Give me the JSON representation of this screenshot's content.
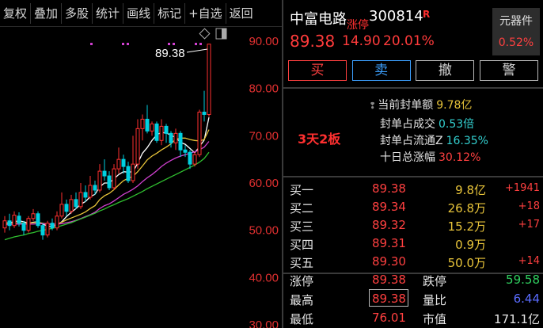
{
  "toolbar": {
    "items": [
      "复权",
      "叠加",
      "多股",
      "统计",
      "画线",
      "标记",
      "+自选",
      "返回"
    ]
  },
  "chart": {
    "y_labels": [
      "90.00",
      "80.00",
      "70.00",
      "60.00",
      "50.00",
      "40.00",
      "30.00"
    ],
    "last_price_label": "89.38",
    "colors": {
      "up": "#ff3030",
      "down": "#00d0e0",
      "ma5": "#ffffff",
      "ma10": "#e8c43a",
      "ma20": "#d040d0",
      "ma60": "#30c030"
    }
  },
  "chart_data": {
    "type": "candlestick",
    "ylim": [
      30,
      90
    ],
    "candles": [
      {
        "o": 50.5,
        "c": 52.0,
        "h": 53.0,
        "l": 49.5
      },
      {
        "o": 52.0,
        "c": 51.0,
        "h": 53.5,
        "l": 50.0
      },
      {
        "o": 51.0,
        "c": 53.2,
        "h": 54.0,
        "l": 50.5
      },
      {
        "o": 53.0,
        "c": 51.5,
        "h": 53.8,
        "l": 50.8
      },
      {
        "o": 51.5,
        "c": 50.0,
        "h": 52.0,
        "l": 49.0
      },
      {
        "o": 50.0,
        "c": 52.5,
        "h": 53.0,
        "l": 49.5
      },
      {
        "o": 52.5,
        "c": 53.5,
        "h": 54.5,
        "l": 52.0
      },
      {
        "o": 53.5,
        "c": 51.0,
        "h": 54.0,
        "l": 50.5
      },
      {
        "o": 51.0,
        "c": 49.0,
        "h": 51.5,
        "l": 48.0
      },
      {
        "o": 49.0,
        "c": 51.5,
        "h": 52.0,
        "l": 48.5
      },
      {
        "o": 51.5,
        "c": 50.5,
        "h": 52.5,
        "l": 50.0
      },
      {
        "o": 50.5,
        "c": 53.0,
        "h": 54.0,
        "l": 50.0
      },
      {
        "o": 53.0,
        "c": 55.5,
        "h": 58.0,
        "l": 52.5
      },
      {
        "o": 55.5,
        "c": 54.0,
        "h": 56.5,
        "l": 53.0
      },
      {
        "o": 54.0,
        "c": 56.5,
        "h": 57.5,
        "l": 53.5
      },
      {
        "o": 56.5,
        "c": 55.0,
        "h": 58.0,
        "l": 54.5
      },
      {
        "o": 55.0,
        "c": 58.0,
        "h": 60.0,
        "l": 54.5
      },
      {
        "o": 58.0,
        "c": 57.0,
        "h": 59.5,
        "l": 56.0
      },
      {
        "o": 57.0,
        "c": 59.5,
        "h": 61.5,
        "l": 56.5
      },
      {
        "o": 59.5,
        "c": 58.5,
        "h": 60.5,
        "l": 57.5
      },
      {
        "o": 58.5,
        "c": 62.5,
        "h": 64.0,
        "l": 58.0
      },
      {
        "o": 62.5,
        "c": 61.5,
        "h": 65.0,
        "l": 60.5
      },
      {
        "o": 61.5,
        "c": 59.0,
        "h": 62.5,
        "l": 58.5
      },
      {
        "o": 59.0,
        "c": 63.0,
        "h": 64.0,
        "l": 58.5
      },
      {
        "o": 63.0,
        "c": 65.0,
        "h": 67.5,
        "l": 62.0
      },
      {
        "o": 65.0,
        "c": 63.5,
        "h": 66.0,
        "l": 62.0
      },
      {
        "o": 63.5,
        "c": 60.5,
        "h": 64.5,
        "l": 60.0
      },
      {
        "o": 60.5,
        "c": 64.0,
        "h": 70.0,
        "l": 60.0
      },
      {
        "o": 64.0,
        "c": 71.5,
        "h": 73.5,
        "l": 63.0
      },
      {
        "o": 71.5,
        "c": 73.5,
        "h": 74.5,
        "l": 69.0
      },
      {
        "o": 73.5,
        "c": 71.0,
        "h": 76.5,
        "l": 70.5
      },
      {
        "o": 71.0,
        "c": 72.5,
        "h": 73.0,
        "l": 70.0
      },
      {
        "o": 72.5,
        "c": 69.0,
        "h": 73.0,
        "l": 68.5
      },
      {
        "o": 69.0,
        "c": 72.0,
        "h": 73.5,
        "l": 68.0
      },
      {
        "o": 72.0,
        "c": 70.5,
        "h": 72.5,
        "l": 68.5
      },
      {
        "o": 70.5,
        "c": 68.5,
        "h": 71.0,
        "l": 67.5
      },
      {
        "o": 68.5,
        "c": 70.5,
        "h": 71.5,
        "l": 67.0
      },
      {
        "o": 70.5,
        "c": 67.0,
        "h": 71.0,
        "l": 65.5
      },
      {
        "o": 67.0,
        "c": 66.5,
        "h": 68.0,
        "l": 65.5
      },
      {
        "o": 66.5,
        "c": 64.0,
        "h": 67.0,
        "l": 63.0
      },
      {
        "o": 64.0,
        "c": 66.0,
        "h": 66.5,
        "l": 63.5
      },
      {
        "o": 66.0,
        "c": 75.0,
        "h": 75.5,
        "l": 65.5
      },
      {
        "o": 75.0,
        "c": 74.5,
        "h": 79.5,
        "l": 73.0
      },
      {
        "o": 74.5,
        "c": 89.38,
        "h": 89.38,
        "l": 74.0
      }
    ],
    "series": [
      {
        "values": [
          51.5,
          51.6,
          51.8,
          52.0,
          51.8,
          51.5,
          51.7,
          51.8,
          51.3,
          50.9,
          50.8,
          51.1,
          51.8,
          52.9,
          53.8,
          54.6,
          55.5,
          56.1,
          57.1,
          57.6,
          59.2,
          60.0,
          60.0,
          60.9,
          61.8,
          62.4,
          62.3,
          62.4,
          64.2,
          66.3,
          67.5,
          69.0,
          70.2,
          70.7,
          70.6,
          70.1,
          69.6,
          68.6,
          68.2,
          67.3,
          66.4,
          67.7,
          69.1,
          73.9
        ]
      },
      {
        "values": [
          51.5,
          51.4,
          51.5,
          51.6,
          51.5,
          51.5,
          51.6,
          51.7,
          51.5,
          51.3,
          51.2,
          51.3,
          51.7,
          52.2,
          52.6,
          53.0,
          53.4,
          53.9,
          54.6,
          55.2,
          56.5,
          57.3,
          57.8,
          58.6,
          59.6,
          60.5,
          61.0,
          61.4,
          62.4,
          63.6,
          64.9,
          65.7,
          66.3,
          67.0,
          67.6,
          68.3,
          69.3,
          69.5,
          69.5,
          69.2,
          69.0,
          68.9,
          69.2,
          71.3
        ]
      },
      {
        "values": [
          51.2,
          51.2,
          51.3,
          51.3,
          51.3,
          51.3,
          51.3,
          51.4,
          51.4,
          51.3,
          51.3,
          51.3,
          51.4,
          51.6,
          51.8,
          52.1,
          52.5,
          52.9,
          53.3,
          53.8,
          54.6,
          55.2,
          55.6,
          56.2,
          56.9,
          57.6,
          58.1,
          58.7,
          59.4,
          60.3,
          61.1,
          61.8,
          62.6,
          63.5,
          64.2,
          64.8,
          65.3,
          65.7,
          66.0,
          66.3,
          66.6,
          67.0,
          67.6,
          68.8
        ]
      },
      {
        "values": [
          48.0,
          48.3,
          48.6,
          48.8,
          49.0,
          49.3,
          49.5,
          49.8,
          50.0,
          50.2,
          50.4,
          50.7,
          51.0,
          51.3,
          51.6,
          52.0,
          52.4,
          52.8,
          53.2,
          53.6,
          54.1,
          54.5,
          55.0,
          55.4,
          55.9,
          56.3,
          56.7,
          57.2,
          57.7,
          58.2,
          58.8,
          59.3,
          59.8,
          60.3,
          60.8,
          61.3,
          61.8,
          62.3,
          62.8,
          63.3,
          63.8,
          64.4,
          65.2,
          66.5
        ]
      }
    ]
  },
  "quote": {
    "name": "中富电路",
    "badge": "涨停",
    "code": "300814",
    "rz": "R",
    "price": "89.38",
    "change": "14.90",
    "pct": "20.01%"
  },
  "sector": {
    "name": "元器件",
    "pct": "0.52%"
  },
  "actions": {
    "buy": "买",
    "sell": "卖",
    "cancel": "撤",
    "alert": "警"
  },
  "limit_up": {
    "tag": "3天2板",
    "stats": [
      {
        "label": "当前封单额",
        "value": "9.78亿"
      },
      {
        "label": "封单占成交",
        "value": "0.53倍"
      },
      {
        "label": "封单占流通Z",
        "value": "16.35%"
      },
      {
        "label": "十日总涨幅",
        "value": "30.12%"
      }
    ]
  },
  "orderbook": [
    {
      "label": "买一",
      "price": "89.38",
      "vol": "9.8亿",
      "delta": "+1941"
    },
    {
      "label": "买二",
      "price": "89.34",
      "vol": "26.8万",
      "delta": "+18"
    },
    {
      "label": "买三",
      "price": "89.32",
      "vol": "15.2万",
      "delta": "+17"
    },
    {
      "label": "买四",
      "price": "89.31",
      "vol": "0.9万",
      "delta": ""
    },
    {
      "label": "买五",
      "price": "89.30",
      "vol": "50.0万",
      "delta": "+14"
    }
  ],
  "summary": [
    {
      "l1": "涨停",
      "v1": "89.38",
      "l2": "跌停",
      "v2": "59.58"
    },
    {
      "l1": "最高",
      "v1": "89.38",
      "l2": "量比",
      "v2": "6.44"
    },
    {
      "l1": "最低",
      "v1": "76.01",
      "l2": "市值",
      "v2": "171.1亿"
    }
  ]
}
